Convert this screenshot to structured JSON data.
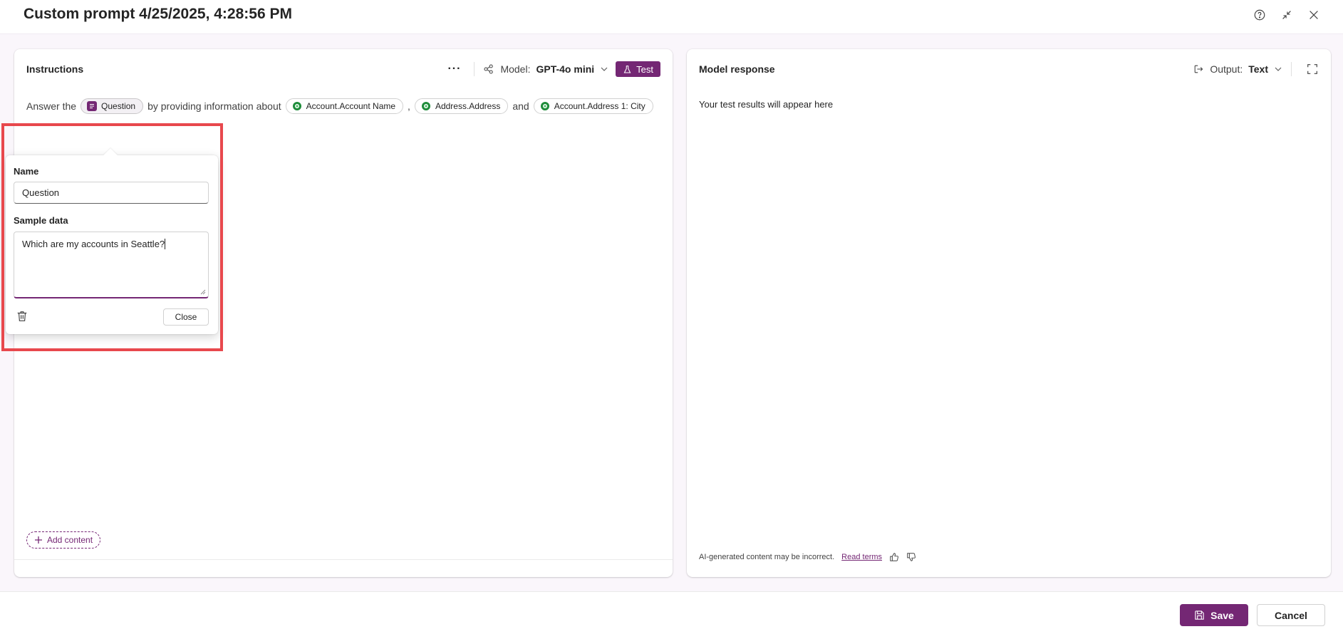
{
  "window": {
    "title": "Custom prompt 4/25/2025, 4:28:56 PM",
    "icons": [
      "help-icon",
      "collapse-icon",
      "close-icon"
    ]
  },
  "instructions": {
    "title": "Instructions",
    "more_label": "···",
    "model_label": "Model:",
    "model_value": "GPT-4o mini",
    "test_label": "Test",
    "prompt": {
      "prefix": "Answer the",
      "input_chip": "Question",
      "middle": "by providing information about",
      "chips": [
        "Account.Account Name",
        "Address.Address",
        "Account.Address 1: City"
      ],
      "comma": ",",
      "and": "and"
    },
    "add_content_label": "Add content"
  },
  "popover": {
    "name_label": "Name",
    "name_value": "Question",
    "sample_label": "Sample data",
    "sample_value": "Which are my accounts in Seattle?",
    "close_label": "Close"
  },
  "response": {
    "title": "Model response",
    "output_label": "Output:",
    "output_value": "Text",
    "placeholder": "Your test results will appear here",
    "disclaimer": "AI-generated content may be incorrect.",
    "terms_link": "Read terms"
  },
  "footer": {
    "save_label": "Save",
    "cancel_label": "Cancel"
  },
  "colors": {
    "accent": "#742774",
    "dataverse_green": "#1e8c3a",
    "highlight": "#e8484d"
  }
}
